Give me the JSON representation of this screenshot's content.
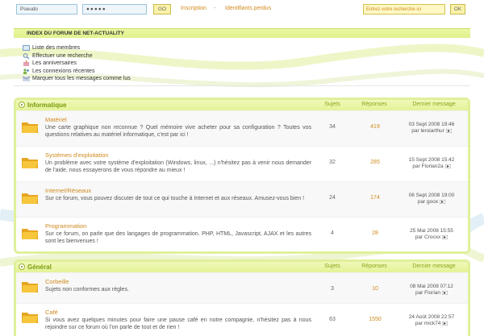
{
  "login": {
    "username_value": "Pseudo",
    "password_value": "●●●●●",
    "go_label": "GO",
    "register_link": "Inscription",
    "separator": "-",
    "lost_credentials_link": "Identifiants perdus"
  },
  "search": {
    "placeholder": "Entrez votre recherche ici",
    "ok_label": "OK"
  },
  "index": {
    "title": "INDEX DU FORUM DE NET-ACTUALITY",
    "menu": [
      {
        "icon": "members-icon",
        "label": "Liste des membres"
      },
      {
        "icon": "search-icon",
        "label": "Effectuer une recherche"
      },
      {
        "icon": "birthday-icon",
        "label": "Les anniversaires"
      },
      {
        "icon": "online-icon",
        "label": "Les connexions récentes"
      },
      {
        "icon": "mark-read-icon",
        "label": "Marquer tous les messages comme lus"
      }
    ]
  },
  "columns": {
    "topics": "Sujets",
    "posts": "Réponses",
    "last": "Dernier message"
  },
  "categories": [
    {
      "name": "Informatique",
      "forums": [
        {
          "title": "Matériel",
          "desc": "Une carte graphique non reconnue ? Quel mémoire vive acheter pour sa configuration ? Toutes vos questions relatives au matériel informatique, c'est par ici !",
          "topics": "34",
          "posts": "419",
          "last_date": "03 Sept 2008 19:46",
          "last_by": "par leroiarthur"
        },
        {
          "title": "Systèmes d'exploitation",
          "desc": "Un problème avec votre système d'exploitation (Windows, linux, ...) n'hésitez pas à venir nous demander de l'aide, nous essayerons de vous répondre au mieux !",
          "topics": "32",
          "posts": "285",
          "last_date": "15 Sept 2008 15:42",
          "last_by": "par Florian2a"
        },
        {
          "title": "Internet/Réseaux",
          "desc": "Sur ce forum, vous pouvez discuter de tout ce qui touche à Internet et aux réseaux. Amusez-vous bien !",
          "topics": "24",
          "posts": "174",
          "last_date": "06 Sept 2008 19:00",
          "last_by": "par goox"
        },
        {
          "title": "Programmation",
          "desc": "Sur ce forum, on parle que des langages de programmation. PHP, HTML, Javascript, AJAX et les autres sont les bienvenues !",
          "topics": "4",
          "posts": "28",
          "last_date": "25 Mai 2008 15:55",
          "last_by": "par Crocxx"
        }
      ]
    },
    {
      "name": "Général",
      "forums": [
        {
          "title": "Corbeille",
          "desc": "Sujets non conformes aux règles.",
          "topics": "3",
          "posts": "10",
          "last_date": "08 Mai 2008 07:12",
          "last_by": "par Florian"
        },
        {
          "title": "Café",
          "desc": "Si vous avez quelques minutes pour faire une pause café en notre compagnie, n'hésitez pas à nous rejoindre sur ce forum où l'on parle de tout et de rien !",
          "topics": "63",
          "posts": "1550",
          "last_date": "24 Août 2008 22:57",
          "last_by": "par mick74"
        }
      ]
    }
  ]
}
